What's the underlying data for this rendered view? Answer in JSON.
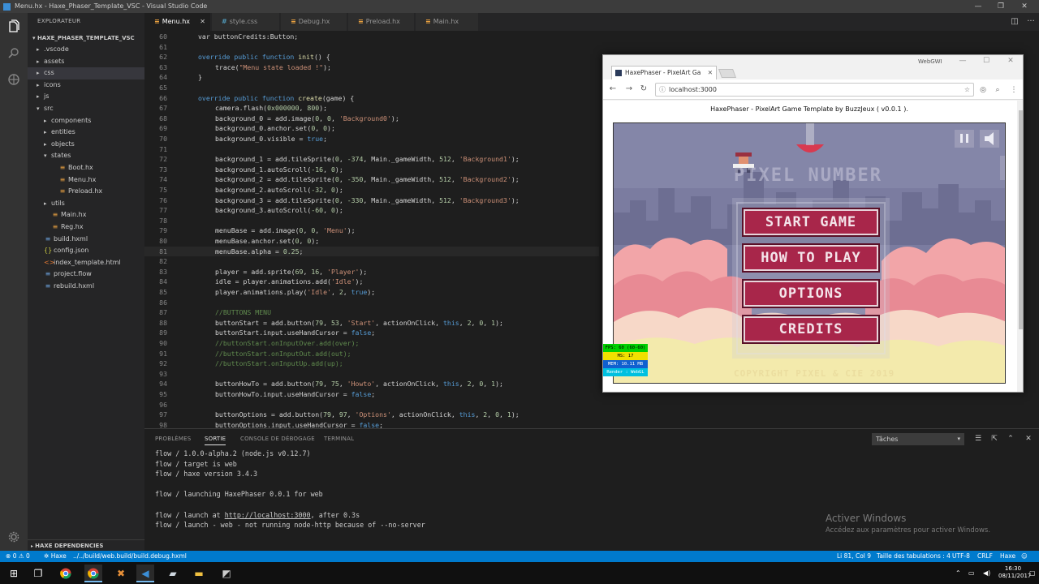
{
  "window": {
    "title": "Menu.hx - Haxe_Phaser_Template_VSC - Visual Studio Code",
    "controls": [
      "—",
      "❐",
      "✕"
    ]
  },
  "activity_bar": {
    "icons": [
      "files-icon",
      "search-icon",
      "extensions-icon",
      "gear-icon"
    ]
  },
  "sidebar": {
    "title": "EXPLORATEUR",
    "folder": "HAXE_PHASER_TEMPLATE_VSC",
    "items": [
      {
        "label": ".vscode",
        "depth": 1,
        "type": "folder",
        "open": false
      },
      {
        "label": "assets",
        "depth": 1,
        "type": "folder",
        "open": false
      },
      {
        "label": "css",
        "depth": 1,
        "type": "folder",
        "open": false,
        "selected": true
      },
      {
        "label": "icons",
        "depth": 1,
        "type": "folder",
        "open": false
      },
      {
        "label": "js",
        "depth": 1,
        "type": "folder",
        "open": false
      },
      {
        "label": "src",
        "depth": 1,
        "type": "folder",
        "open": true
      },
      {
        "label": "components",
        "depth": 2,
        "type": "folder",
        "open": false
      },
      {
        "label": "entities",
        "depth": 2,
        "type": "folder",
        "open": false
      },
      {
        "label": "objects",
        "depth": 2,
        "type": "folder",
        "open": false
      },
      {
        "label": "states",
        "depth": 2,
        "type": "folder",
        "open": true
      },
      {
        "label": "Boot.hx",
        "depth": 3,
        "type": "hx"
      },
      {
        "label": "Menu.hx",
        "depth": 3,
        "type": "hx"
      },
      {
        "label": "Preload.hx",
        "depth": 3,
        "type": "hx"
      },
      {
        "label": "utils",
        "depth": 2,
        "type": "folder",
        "open": false
      },
      {
        "label": "Main.hx",
        "depth": 2,
        "type": "hx"
      },
      {
        "label": "Reg.hx",
        "depth": 2,
        "type": "hx"
      },
      {
        "label": "build.hxml",
        "depth": 1,
        "type": "hxml"
      },
      {
        "label": "config.json",
        "depth": 1,
        "type": "json"
      },
      {
        "label": "index_template.html",
        "depth": 1,
        "type": "html"
      },
      {
        "label": "project.flow",
        "depth": 1,
        "type": "hxml"
      },
      {
        "label": "rebuild.hxml",
        "depth": 1,
        "type": "hxml"
      }
    ],
    "bottom_section": "HAXE DEPENDENCIES"
  },
  "tabs": [
    {
      "label": "Menu.hx",
      "icon": "≡",
      "active": true
    },
    {
      "label": "style.css",
      "icon": "#",
      "active": false
    },
    {
      "label": "Debug.hx",
      "icon": "≡",
      "active": false
    },
    {
      "label": "Preload.hx",
      "icon": "≡",
      "active": false
    },
    {
      "label": "Main.hx",
      "icon": "≡",
      "active": false
    }
  ],
  "editor": {
    "current_line": 81,
    "lines": [
      {
        "n": 60,
        "indent": 0,
        "t": [
          [
            "var buttonCredits:Button;",
            ""
          ]
        ]
      },
      {
        "n": 61,
        "indent": 0,
        "t": []
      },
      {
        "n": 62,
        "indent": 0,
        "t": [
          [
            "override public function ",
            "kw"
          ],
          [
            "init",
            "fn"
          ],
          [
            "() {",
            ""
          ]
        ]
      },
      {
        "n": 63,
        "indent": 1,
        "t": [
          [
            "trace(",
            ""
          ],
          [
            "\"Menu state loaded !\"",
            "str"
          ],
          [
            ");",
            ""
          ]
        ]
      },
      {
        "n": 64,
        "indent": 0,
        "t": [
          [
            "}",
            ""
          ]
        ]
      },
      {
        "n": 65,
        "indent": 0,
        "t": []
      },
      {
        "n": 66,
        "indent": 0,
        "t": [
          [
            "override public function ",
            "kw"
          ],
          [
            "create",
            "fn"
          ],
          [
            "(game) {",
            ""
          ]
        ]
      },
      {
        "n": 67,
        "indent": 1,
        "t": [
          [
            "camera.flash(",
            ""
          ],
          [
            "0x000000",
            "num"
          ],
          [
            ", ",
            ""
          ],
          [
            "800",
            "num"
          ],
          [
            ");",
            ""
          ]
        ]
      },
      {
        "n": 68,
        "indent": 1,
        "t": [
          [
            "background_0 = add.image(",
            ""
          ],
          [
            "0",
            "num"
          ],
          [
            ", ",
            ""
          ],
          [
            "0",
            "num"
          ],
          [
            ", ",
            ""
          ],
          [
            "'Background0'",
            "str"
          ],
          [
            ");",
            ""
          ]
        ]
      },
      {
        "n": 69,
        "indent": 1,
        "t": [
          [
            "background_0.anchor.set(",
            ""
          ],
          [
            "0",
            "num"
          ],
          [
            ", ",
            ""
          ],
          [
            "0",
            "num"
          ],
          [
            ");",
            ""
          ]
        ]
      },
      {
        "n": 70,
        "indent": 1,
        "t": [
          [
            "background_0.visible = ",
            ""
          ],
          [
            "true",
            "kw"
          ],
          [
            ";",
            ""
          ]
        ]
      },
      {
        "n": 71,
        "indent": 0,
        "t": []
      },
      {
        "n": 72,
        "indent": 1,
        "t": [
          [
            "background_1 = add.tileSprite(",
            ""
          ],
          [
            "0",
            "num"
          ],
          [
            ", ",
            ""
          ],
          [
            "-374",
            "num"
          ],
          [
            ", Main._gameWidth, ",
            ""
          ],
          [
            "512",
            "num"
          ],
          [
            ", ",
            ""
          ],
          [
            "'Background1'",
            "str"
          ],
          [
            ");",
            ""
          ]
        ]
      },
      {
        "n": 73,
        "indent": 1,
        "t": [
          [
            "background_1.autoScroll(",
            ""
          ],
          [
            "-16",
            "num"
          ],
          [
            ", ",
            ""
          ],
          [
            "0",
            "num"
          ],
          [
            ");",
            ""
          ]
        ]
      },
      {
        "n": 74,
        "indent": 1,
        "t": [
          [
            "background_2 = add.tileSprite(",
            ""
          ],
          [
            "0",
            "num"
          ],
          [
            ", ",
            ""
          ],
          [
            "-350",
            "num"
          ],
          [
            ", Main._gameWidth, ",
            ""
          ],
          [
            "512",
            "num"
          ],
          [
            ", ",
            ""
          ],
          [
            "'Background2'",
            "str"
          ],
          [
            ");",
            ""
          ]
        ]
      },
      {
        "n": 75,
        "indent": 1,
        "t": [
          [
            "background_2.autoScroll(",
            ""
          ],
          [
            "-32",
            "num"
          ],
          [
            ", ",
            ""
          ],
          [
            "0",
            "num"
          ],
          [
            ");",
            ""
          ]
        ]
      },
      {
        "n": 76,
        "indent": 1,
        "t": [
          [
            "background_3 = add.tileSprite(",
            ""
          ],
          [
            "0",
            "num"
          ],
          [
            ", ",
            ""
          ],
          [
            "-330",
            "num"
          ],
          [
            ", Main._gameWidth, ",
            ""
          ],
          [
            "512",
            "num"
          ],
          [
            ", ",
            ""
          ],
          [
            "'Background3'",
            "str"
          ],
          [
            ");",
            ""
          ]
        ]
      },
      {
        "n": 77,
        "indent": 1,
        "t": [
          [
            "background_3.autoScroll(",
            ""
          ],
          [
            "-60",
            "num"
          ],
          [
            ", ",
            ""
          ],
          [
            "0",
            "num"
          ],
          [
            ");",
            ""
          ]
        ]
      },
      {
        "n": 78,
        "indent": 0,
        "t": []
      },
      {
        "n": 79,
        "indent": 1,
        "t": [
          [
            "menuBase = add.image(",
            ""
          ],
          [
            "0",
            "num"
          ],
          [
            ", ",
            ""
          ],
          [
            "0",
            "num"
          ],
          [
            ", ",
            ""
          ],
          [
            "'Menu'",
            "str"
          ],
          [
            ");",
            ""
          ]
        ]
      },
      {
        "n": 80,
        "indent": 1,
        "t": [
          [
            "menuBase.anchor.set(",
            ""
          ],
          [
            "0",
            "num"
          ],
          [
            ", ",
            ""
          ],
          [
            "0",
            "num"
          ],
          [
            ");",
            ""
          ]
        ]
      },
      {
        "n": 81,
        "indent": 1,
        "t": [
          [
            "menuBase.alpha = ",
            ""
          ],
          [
            "0.25",
            "num"
          ],
          [
            ";",
            ""
          ]
        ]
      },
      {
        "n": 82,
        "indent": 0,
        "t": []
      },
      {
        "n": 83,
        "indent": 1,
        "t": [
          [
            "player = add.sprite(",
            ""
          ],
          [
            "69",
            "num"
          ],
          [
            ", ",
            ""
          ],
          [
            "16",
            "num"
          ],
          [
            ", ",
            ""
          ],
          [
            "'Player'",
            "str"
          ],
          [
            ");",
            ""
          ]
        ]
      },
      {
        "n": 84,
        "indent": 1,
        "t": [
          [
            "idle = player.animations.add(",
            ""
          ],
          [
            "'Idle'",
            "str"
          ],
          [
            ");",
            ""
          ]
        ]
      },
      {
        "n": 85,
        "indent": 1,
        "t": [
          [
            "player.animations.play(",
            ""
          ],
          [
            "'Idle'",
            "str"
          ],
          [
            ", ",
            ""
          ],
          [
            "2",
            "num"
          ],
          [
            ", ",
            ""
          ],
          [
            "true",
            "kw"
          ],
          [
            ");",
            ""
          ]
        ]
      },
      {
        "n": 86,
        "indent": 0,
        "t": []
      },
      {
        "n": 87,
        "indent": 1,
        "t": [
          [
            "//BUTTONS MENU",
            "com"
          ]
        ]
      },
      {
        "n": 88,
        "indent": 1,
        "t": [
          [
            "buttonStart = add.button(",
            ""
          ],
          [
            "79",
            "num"
          ],
          [
            ", ",
            ""
          ],
          [
            "53",
            "num"
          ],
          [
            ", ",
            ""
          ],
          [
            "'Start'",
            "str"
          ],
          [
            ", actionOnClick, ",
            ""
          ],
          [
            "this",
            "kw"
          ],
          [
            ", ",
            ""
          ],
          [
            "2",
            "num"
          ],
          [
            ", ",
            ""
          ],
          [
            "0",
            "num"
          ],
          [
            ", ",
            ""
          ],
          [
            "1",
            "num"
          ],
          [
            ");",
            ""
          ]
        ]
      },
      {
        "n": 89,
        "indent": 1,
        "t": [
          [
            "buttonStart.input.useHandCursor = ",
            ""
          ],
          [
            "false",
            "kw"
          ],
          [
            ";",
            ""
          ]
        ]
      },
      {
        "n": 90,
        "indent": 1,
        "t": [
          [
            "//buttonStart.onInputOver.add(over);",
            "com"
          ]
        ]
      },
      {
        "n": 91,
        "indent": 1,
        "t": [
          [
            "//buttonStart.onInputOut.add(out);",
            "com"
          ]
        ]
      },
      {
        "n": 92,
        "indent": 1,
        "t": [
          [
            "//buttonStart.onInputUp.add(up);",
            "com"
          ]
        ]
      },
      {
        "n": 93,
        "indent": 0,
        "t": []
      },
      {
        "n": 94,
        "indent": 1,
        "t": [
          [
            "buttonHowTo = add.button(",
            ""
          ],
          [
            "79",
            "num"
          ],
          [
            ", ",
            ""
          ],
          [
            "75",
            "num"
          ],
          [
            ", ",
            ""
          ],
          [
            "'Howto'",
            "str"
          ],
          [
            ", actionOnClick, ",
            ""
          ],
          [
            "this",
            "kw"
          ],
          [
            ", ",
            ""
          ],
          [
            "2",
            "num"
          ],
          [
            ", ",
            ""
          ],
          [
            "0",
            "num"
          ],
          [
            ", ",
            ""
          ],
          [
            "1",
            "num"
          ],
          [
            ");",
            ""
          ]
        ]
      },
      {
        "n": 95,
        "indent": 1,
        "t": [
          [
            "buttonHowTo.input.useHandCursor = ",
            ""
          ],
          [
            "false",
            "kw"
          ],
          [
            ";",
            ""
          ]
        ]
      },
      {
        "n": 96,
        "indent": 0,
        "t": []
      },
      {
        "n": 97,
        "indent": 1,
        "t": [
          [
            "buttonOptions = add.button(",
            ""
          ],
          [
            "79",
            "num"
          ],
          [
            ", ",
            ""
          ],
          [
            "97",
            "num"
          ],
          [
            ", ",
            ""
          ],
          [
            "'Options'",
            "str"
          ],
          [
            ", actionOnClick, ",
            ""
          ],
          [
            "this",
            "kw"
          ],
          [
            ", ",
            ""
          ],
          [
            "2",
            "num"
          ],
          [
            ", ",
            ""
          ],
          [
            "0",
            "num"
          ],
          [
            ", ",
            ""
          ],
          [
            "1",
            "num"
          ],
          [
            ");",
            ""
          ]
        ]
      },
      {
        "n": 98,
        "indent": 1,
        "t": [
          [
            "buttonOptions.input.useHandCursor = ",
            ""
          ],
          [
            "false",
            "kw"
          ],
          [
            ";",
            ""
          ]
        ]
      }
    ]
  },
  "browser": {
    "tab_title": "HaxePhaser - PixelArt Ga",
    "user_label": "WebGWI",
    "url": "localhost:3000",
    "page_heading": "HaxePhaser - PixelArt Game Template by BuzzJeux ( v0.0.1 ).",
    "game": {
      "background_title": "PIXEL NUMBER",
      "buttons": [
        "START GAME",
        "HOW TO PLAY",
        "OPTIONS",
        "CREDITS"
      ],
      "footer": "COPYRIGHT PIXEL & CIE 2019",
      "stats": [
        {
          "label": "FPS: 60 (60-60)",
          "color": "#00d000"
        },
        {
          "label": "MS: 17",
          "color": "#f0e000"
        },
        {
          "label": "MEM: 10.11 MB",
          "color": "#1060d0"
        },
        {
          "label": "Render : WebGL",
          "color": "#00c0e0"
        }
      ]
    }
  },
  "panel": {
    "tabs": [
      "PROBLÈMES",
      "SORTIE",
      "CONSOLE DE DÉBOGAGE",
      "TERMINAL"
    ],
    "active_tab": "SORTIE",
    "dropdown": "Tâches",
    "output": [
      "flow / 1.0.0-alpha.2 (node.js v0.12.7)",
      "flow / target is web",
      "flow / haxe version 3.4.3",
      "",
      "flow / launching HaxePhaser 0.0.1 for web",
      "",
      "flow / launch at |http://localhost:3000|, after 0.3s",
      "flow / launch - web - not running node-http because of --no-server"
    ],
    "watermark_title": "Activer Windows",
    "watermark_sub": "Accédez aux paramètres pour activer Windows."
  },
  "statusbar": {
    "errors": "0",
    "warnings": "0",
    "language_server": "Haxe",
    "build_file": "../../build/web.build/build.debug.hxml",
    "position": "Li 81, Col 9",
    "tab_size": "Taille des tabulations : 4",
    "encoding": "UTF-8",
    "eol": "CRLF",
    "language": "Haxe"
  },
  "taskbar": {
    "time": "16:30",
    "date": "08/11/2017"
  },
  "colors": {
    "accent": "#007acc",
    "button_red": "#a8264a",
    "editor_bg": "#1e1e1e"
  }
}
